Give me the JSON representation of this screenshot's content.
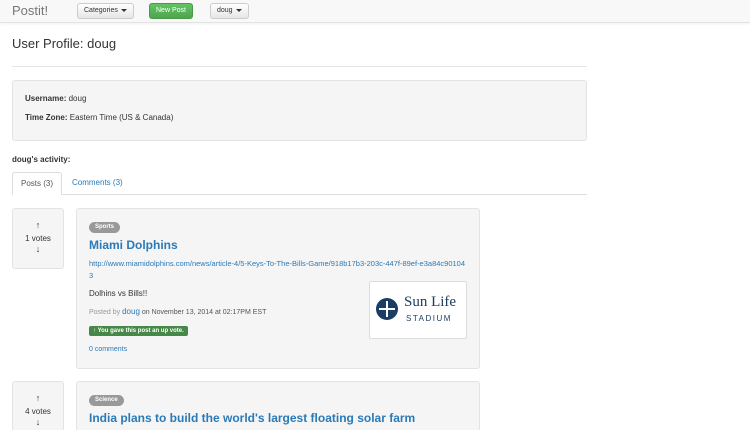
{
  "navbar": {
    "brand": "Postit!",
    "categories_label": "Categories",
    "new_post_label": "New Post",
    "user_label": "doug"
  },
  "profile": {
    "title": "User Profile: doug",
    "username_label": "Username:",
    "username_value": "doug",
    "timezone_label": "Time Zone:",
    "timezone_value": "Eastern Time (US & Canada)"
  },
  "activity": {
    "heading": "doug's activity:",
    "tabs": [
      {
        "label": "Posts (3)",
        "active": true
      },
      {
        "label": "Comments (3)",
        "active": false
      }
    ]
  },
  "posts": [
    {
      "votes": "1 votes",
      "category": "Sports",
      "title": "Miami Dolphins",
      "url": "http://www.miamidolphins.com/news/article-4/5-Keys-To-The-Bills-Game/918b17b3-203c-447f-89ef-e3a84c901043",
      "description": "Dolhins vs Bills!!",
      "posted_by_prefix": "Posted by",
      "author": "doug",
      "posted_on": "on November 13, 2014 at 02:17PM EST",
      "vote_note": "You gave this post an up vote.",
      "comments": "0 comments",
      "image": {
        "line1": "Sun Life",
        "line2": "STADIUM"
      }
    },
    {
      "votes": "4 votes",
      "category": "Science",
      "title": "India plans to build the world's largest floating solar farm"
    }
  ],
  "colors": {
    "link": "#2a7ab8",
    "primary_button": "#5bb75b",
    "vote_note": "#468847",
    "badge": "#999999"
  }
}
